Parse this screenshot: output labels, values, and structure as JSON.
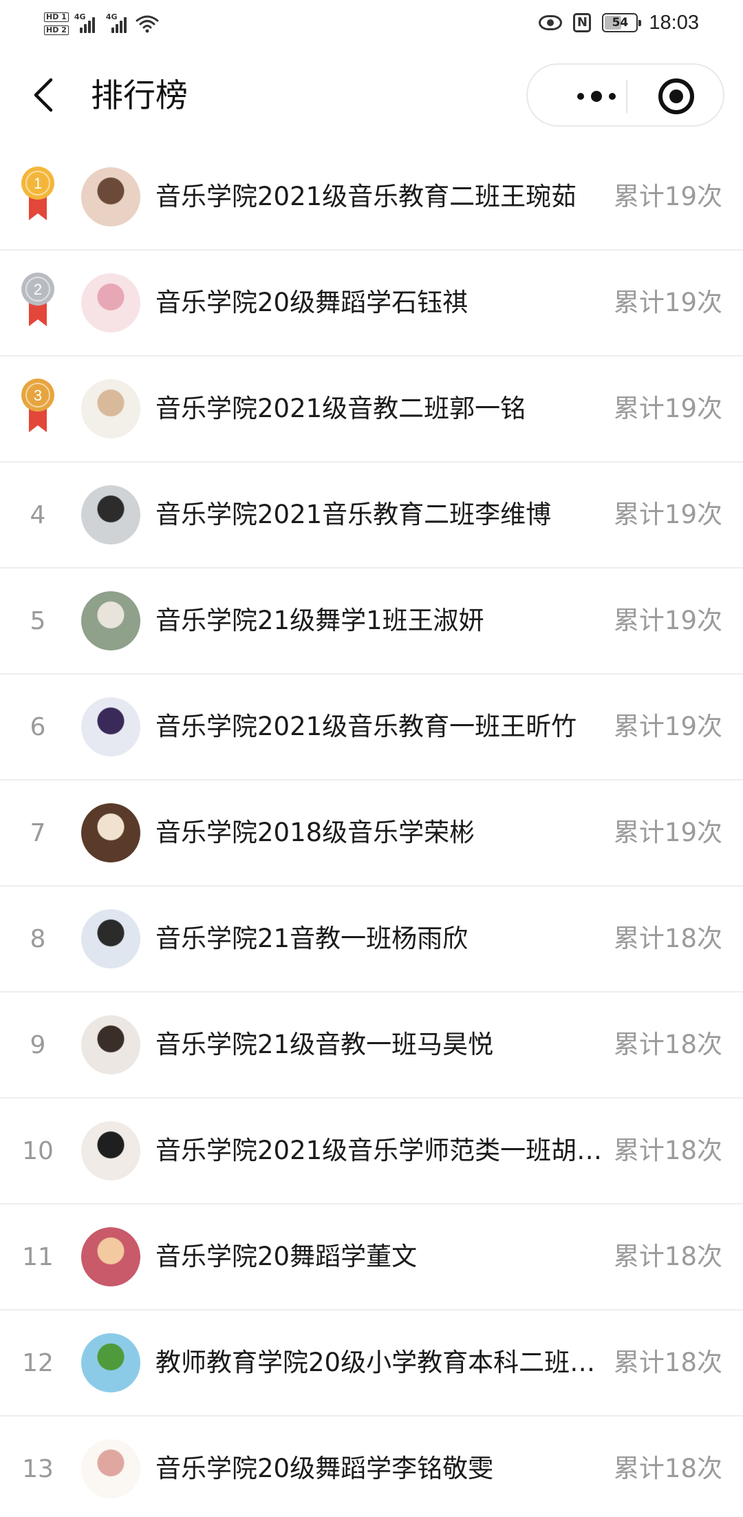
{
  "status_bar": {
    "hd1": "HD 1",
    "hd2": "HD 2",
    "sim1_label": "4G",
    "sim2_label": "4G",
    "battery": "54",
    "battery_level": 0.54,
    "time": "18:03",
    "icons": [
      "signal-icon",
      "wifi-icon",
      "eye-icon",
      "nfc-icon",
      "battery-icon"
    ]
  },
  "nav": {
    "title": "排行榜",
    "back_icon": "chevron-left-icon",
    "more_icon": "more-dots-icon",
    "close_icon": "target-icon"
  },
  "colors": {
    "gold": "#f4b63a",
    "silver": "#b8bcc2",
    "bronze": "#e7a53f",
    "ribbon": "#e2473a",
    "text": "#1b1b1b",
    "muted": "#9b9b9b"
  },
  "ranking": [
    {
      "rank": "1",
      "medal": "gold",
      "name": "音乐学院2021级音乐教育二班王琬茹",
      "count": "累计19次"
    },
    {
      "rank": "2",
      "medal": "silver",
      "name": "音乐学院20级舞蹈学石钰祺",
      "count": "累计19次"
    },
    {
      "rank": "3",
      "medal": "bronze",
      "name": "音乐学院2021级音教二班郭一铭",
      "count": "累计19次"
    },
    {
      "rank": "4",
      "medal": "",
      "name": "音乐学院2021音乐教育二班李维博",
      "count": "累计19次"
    },
    {
      "rank": "5",
      "medal": "",
      "name": "音乐学院21级舞学1班王淑妍",
      "count": "累计19次"
    },
    {
      "rank": "6",
      "medal": "",
      "name": "音乐学院2021级音乐教育一班王昕竹",
      "count": "累计19次"
    },
    {
      "rank": "7",
      "medal": "",
      "name": "音乐学院2018级音乐学荣彬",
      "count": "累计19次"
    },
    {
      "rank": "8",
      "medal": "",
      "name": "音乐学院21音教一班杨雨欣",
      "count": "累计18次"
    },
    {
      "rank": "9",
      "medal": "",
      "name": "音乐学院21级音教一班马昊悦",
      "count": "累计18次"
    },
    {
      "rank": "10",
      "medal": "",
      "name": "音乐学院2021级音乐学师范类一班胡…",
      "count": "累计18次"
    },
    {
      "rank": "11",
      "medal": "",
      "name": "音乐学院20舞蹈学董文",
      "count": "累计18次"
    },
    {
      "rank": "12",
      "medal": "",
      "name": "教师教育学院20级小学教育本科二班…",
      "count": "累计18次"
    },
    {
      "rank": "13",
      "medal": "",
      "name": "音乐学院20级舞蹈学李铭敬雯",
      "count": "累计18次"
    }
  ]
}
